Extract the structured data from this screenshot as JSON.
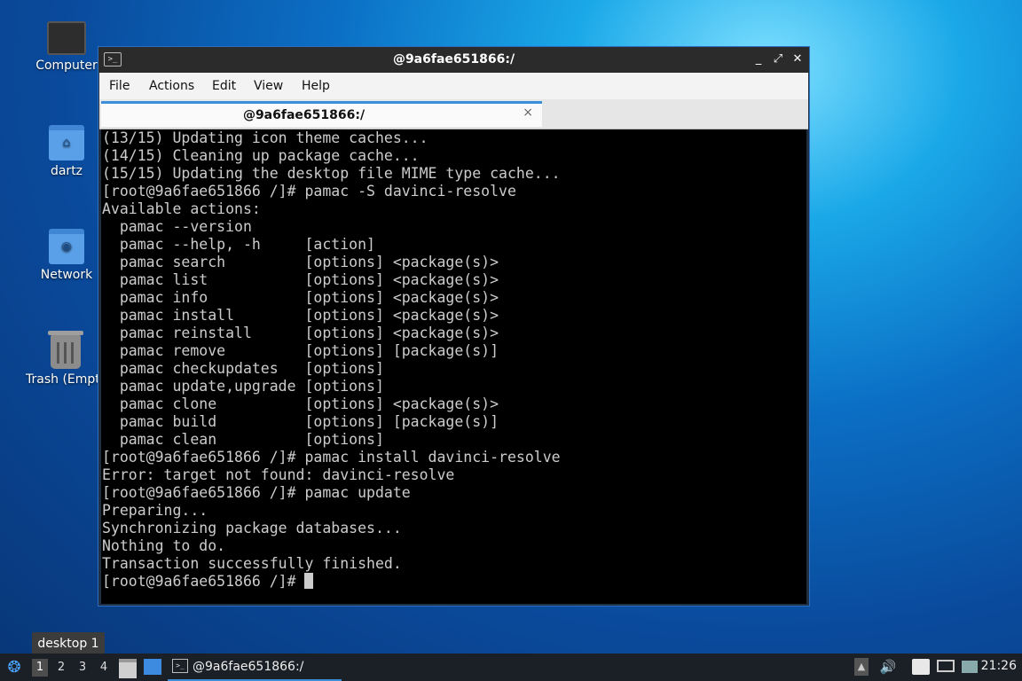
{
  "desktop": {
    "icons": [
      {
        "label": "Computer"
      },
      {
        "label": "dartz"
      },
      {
        "label": "Network"
      },
      {
        "label": "Trash (Empt"
      }
    ]
  },
  "window": {
    "title": "@9a6fae651866:/",
    "menu": [
      "File",
      "Actions",
      "Edit",
      "View",
      "Help"
    ],
    "tab": {
      "title": "@9a6fae651866:/",
      "close": "×"
    },
    "controls": {
      "minimize": "_",
      "maximize": "⤢",
      "close": "✕"
    }
  },
  "terminal": {
    "lines": [
      "(13/15) Updating icon theme caches...",
      "(14/15) Cleaning up package cache...",
      "(15/15) Updating the desktop file MIME type cache...",
      "[root@9a6fae651866 /]# pamac -S davinci-resolve",
      "Available actions:",
      "  pamac --version",
      "  pamac --help, -h     [action]",
      "  pamac search         [options] <package(s)>",
      "  pamac list           [options] <package(s)>",
      "  pamac info           [options] <package(s)>",
      "  pamac install        [options] <package(s)>",
      "  pamac reinstall      [options] <package(s)>",
      "  pamac remove         [options] [package(s)]",
      "  pamac checkupdates   [options]",
      "  pamac update,upgrade [options]",
      "  pamac clone          [options] <package(s)>",
      "  pamac build          [options] [package(s)]",
      "  pamac clean          [options]",
      "[root@9a6fae651866 /]# pamac install davinci-resolve",
      "Error: target not found: davinci-resolve",
      "[root@9a6fae651866 /]# pamac update",
      "Preparing...",
      "Synchronizing package databases...",
      "Nothing to do.",
      "Transaction successfully finished."
    ],
    "prompt": "[root@9a6fae651866 /]# "
  },
  "taskbar": {
    "tooltip": "desktop 1",
    "desktops": [
      "1",
      "2",
      "3",
      "4"
    ],
    "active_desktop": "1",
    "task_label": "@9a6fae651866:/",
    "clock": "21:26",
    "tray_icons": [
      "up-arrow-icon",
      "volume-icon",
      "clipboard-icon",
      "network-icon",
      "monitor-icon"
    ]
  }
}
